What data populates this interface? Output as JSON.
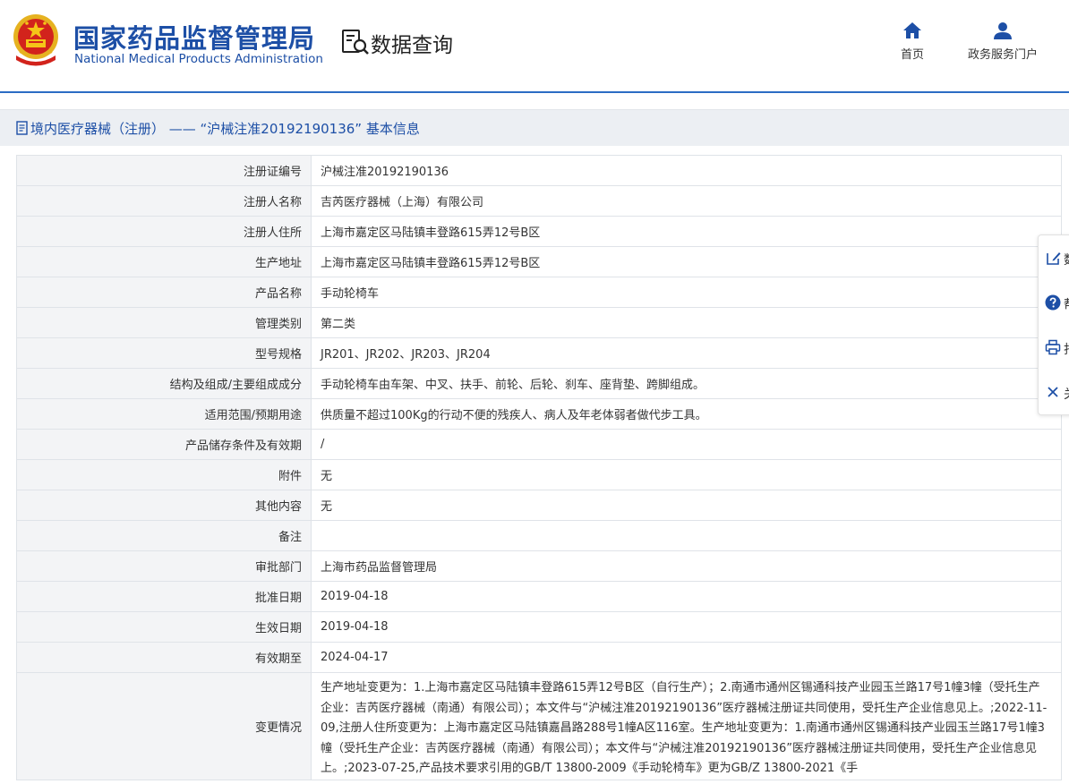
{
  "header": {
    "brand_cn": "国家药品监督管理局",
    "brand_en": "National Medical Products Administration",
    "query_title": "数据查询",
    "nav": [
      {
        "label": "首页",
        "icon": "home-icon"
      },
      {
        "label": "政务服务门户",
        "icon": "user-icon"
      }
    ],
    "accent_color": "#1d4fa6"
  },
  "titlebar": {
    "text": "境内医疗器械（注册） ——  “沪械注准20192190136” 基本信息"
  },
  "rows": [
    {
      "label": "注册证编号",
      "value": "沪械注准20192190136"
    },
    {
      "label": "注册人名称",
      "value": "吉芮医疗器械（上海）有限公司"
    },
    {
      "label": "注册人住所",
      "value": "上海市嘉定区马陆镇丰登路615弄12号B区"
    },
    {
      "label": "生产地址",
      "value": "上海市嘉定区马陆镇丰登路615弄12号B区"
    },
    {
      "label": "产品名称",
      "value": "手动轮椅车"
    },
    {
      "label": "管理类别",
      "value": "第二类"
    },
    {
      "label": "型号规格",
      "value": "JR201、JR202、JR203、JR204"
    },
    {
      "label": "结构及组成/主要组成成分",
      "value": "手动轮椅车由车架、中叉、扶手、前轮、后轮、刹车、座背垫、跨脚组成。"
    },
    {
      "label": "适用范围/预期用途",
      "value": "供质量不超过100Kg的行动不便的残疾人、病人及年老体弱者做代步工具。"
    },
    {
      "label": "产品储存条件及有效期",
      "value": "/"
    },
    {
      "label": "附件",
      "value": "无"
    },
    {
      "label": "其他内容",
      "value": "无"
    },
    {
      "label": "备注",
      "value": ""
    },
    {
      "label": "审批部门",
      "value": "上海市药品监督管理局"
    },
    {
      "label": "批准日期",
      "value": "2019-04-18"
    },
    {
      "label": "生效日期",
      "value": "2019-04-18"
    },
    {
      "label": "有效期至",
      "value": "2024-04-17"
    },
    {
      "label": "变更情况",
      "value": "生产地址变更为：1.上海市嘉定区马陆镇丰登路615弄12号B区（自行生产）；2.南通市通州区锡通科技产业园玉兰路17号1幢3幢（受托生产企业：吉芮医疗器械（南通）有限公司）；本文件与“沪械注准20192190136”医疗器械注册证共同使用，受托生产企业信息见上。;2022-11-09,注册人住所变更为：上海市嘉定区马陆镇嘉昌路288号1幢A区116室。生产地址变更为：1.南通市通州区锡通科技产业园玉兰路17号1幢3幢（受托生产企业：吉芮医疗器械（南通）有限公司）；本文件与“沪械注准20192190136”医疗器械注册证共同使用，受托生产企业信息见上。;2023-07-25,产品技术要求引用的GB/T 13800-2009《手动轮椅车》更为GB/Z 13800-2021《手"
    }
  ],
  "float_bar": [
    {
      "icon": "edit-icon",
      "label": "数"
    },
    {
      "icon": "help-icon",
      "label": "帮"
    },
    {
      "icon": "print-icon",
      "label": "打"
    },
    {
      "icon": "close-icon",
      "label": "关"
    }
  ]
}
